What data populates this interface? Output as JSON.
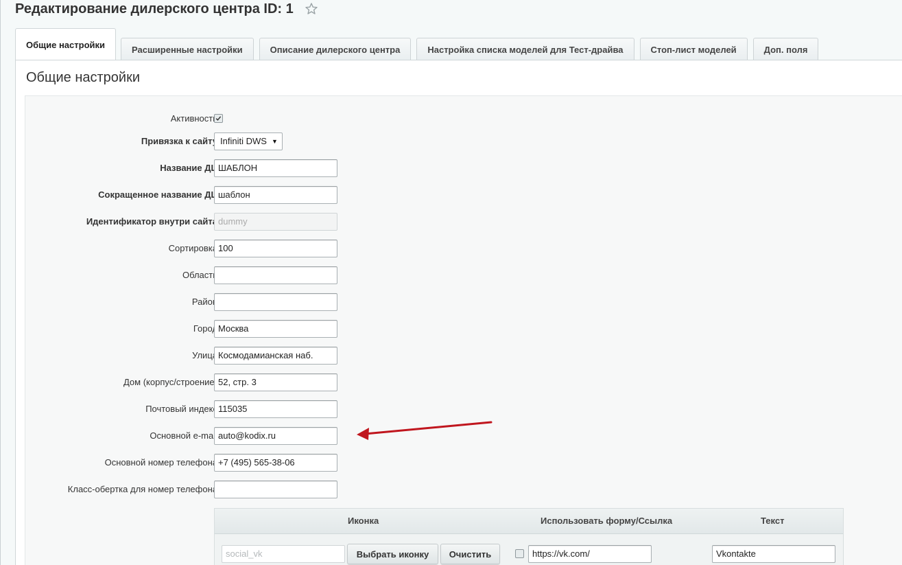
{
  "header": {
    "title": "Редактирование дилерского центра ID: 1",
    "star_icon": "star-icon"
  },
  "tabs": [
    {
      "label": "Общие настройки",
      "active": true
    },
    {
      "label": "Расширенные настройки",
      "active": false
    },
    {
      "label": "Описание дилерского центра",
      "active": false
    },
    {
      "label": "Настройка списка моделей для Тест-драйва",
      "active": false
    },
    {
      "label": "Стоп-лист моделей",
      "active": false
    },
    {
      "label": "Доп. поля",
      "active": false
    }
  ],
  "section": {
    "title": "Общие настройки"
  },
  "form": {
    "active": {
      "label": "Активность",
      "checked": true
    },
    "site": {
      "label": "Привязка к сайту",
      "value": "Infiniti DWS"
    },
    "dc_name": {
      "label": "Название ДЦ",
      "value": "ШАБЛОН"
    },
    "dc_short_name": {
      "label": "Сокращенное название ДЦ",
      "value": "шаблон"
    },
    "site_id": {
      "label": "Идентификатор внутри сайта",
      "value": "dummy"
    },
    "sort": {
      "label": "Сортировка",
      "value": "100"
    },
    "region": {
      "label": "Область",
      "value": ""
    },
    "district": {
      "label": "Район",
      "value": ""
    },
    "city": {
      "label": "Город",
      "value": "Москва"
    },
    "street": {
      "label": "Улица",
      "value": "Космодамианская наб."
    },
    "house": {
      "label": "Дом (корпус/строение)",
      "value": "52, стр. 3"
    },
    "zip": {
      "label": "Почтовый индекс",
      "value": "115035"
    },
    "email": {
      "label": "Основной e-mail",
      "value": "auto@kodix.ru"
    },
    "phone": {
      "label": "Основной номер телефона",
      "value": "+7 (495) 565-38-06"
    },
    "phone_class": {
      "label": "Класс-обертка для номер телефона",
      "value": ""
    }
  },
  "social_table": {
    "headers": {
      "icon": "Иконка",
      "use_form": "Использовать форму/Ссылка",
      "text": "Текст"
    },
    "rows": [
      {
        "icon_placeholder": "social_vk",
        "choose_icon_label": "Выбрать иконку",
        "clear_label": "Очистить",
        "use_form_checked": false,
        "link": "https://vk.com/",
        "text": "Vkontakte"
      }
    ]
  },
  "colors": {
    "annotation_arrow": "#c0161e",
    "accent_border": "#a9b0b3"
  }
}
